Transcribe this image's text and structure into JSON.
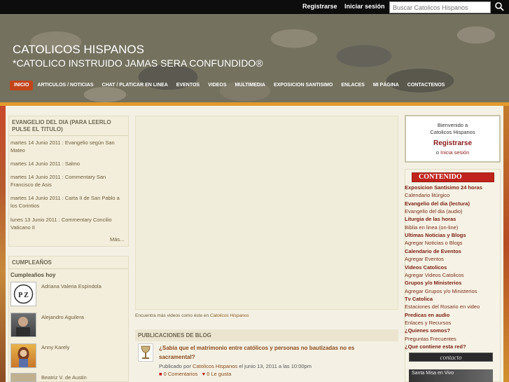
{
  "topbar": {
    "register": "Registrarse",
    "login": "Iniciar sesión",
    "search_placeholder": "Buscar Catolicos Hispanos"
  },
  "site": {
    "title": "CATOLICOS HISPANOS",
    "tagline": "*CATOLICO INSTRUIDO JAMAS SERA CONFUNDIDO®"
  },
  "nav": [
    "INICIO",
    "ARTICULOS / NOTICIAS",
    "CHAT / PLATICAR EN LINEA",
    "EVENTOS",
    "VIDEOS",
    "MULTIMEDIA",
    "EXPOSICION SANTISIMO",
    "ENLACES",
    "MI PÁGINA",
    "CONTACTENOS"
  ],
  "gospel": {
    "header": "EVANGELIO DEL DIA (PARA LEERLO PULSE EL TITULO)",
    "items": [
      "martes 14 Junio 2011 : Evangelio según San Mateo",
      "martes 14 Junio 2011 : Salmo",
      "martes 14 Junio 2011 : Commentary San Francisco de Asis",
      "martes 14 Junio 2011 : Carta II de San Pablo a los Corintios",
      "lunes 13 Junio 2011 : Commentary Concilio Vaticano II"
    ],
    "more": "Más..."
  },
  "birthdays": {
    "header": "CUMPLEAÑOS",
    "today": "Cumpleaños hoy",
    "people": [
      "Adriana Valeria Espindola",
      "Alejandro Aguilera",
      "Anny Karely",
      "Beatriz V. de Austin"
    ]
  },
  "video": {
    "caption_prefix": "Encuentra más videos como éste en",
    "caption_link": "Catolicos Hispanos"
  },
  "blog": {
    "header": "PUBLICACIONES DE BLOG",
    "post_title": "¿Sabía que el matrimonio entre católicos y personas no bautizadas no es sacramental?",
    "meta_by": "Publicado por",
    "author": "Catolicos Hispanos",
    "date": "el junio 13, 2011 a las 10:00pm",
    "comments": "0 Comentarios",
    "likes": "0 Le gusta"
  },
  "welcome": {
    "line1": "Bienvenido a",
    "line2": "Catolicos Hispanos",
    "register": "Registrarse",
    "or": "o",
    "login": "Inicia sesión"
  },
  "contenido": {
    "header": "CONTENIDO",
    "items": [
      {
        "label": "Exposicion Santisimo 24 horas",
        "bold": true
      },
      {
        "label": "Calendario litúrgico",
        "bold": false
      },
      {
        "label": "Evangelio del dia (lectura)",
        "bold": true
      },
      {
        "label": "Evangelio del dia (audio)",
        "bold": false
      },
      {
        "label": "Liturgia de las horas",
        "bold": true
      },
      {
        "label": "Biblia en linea (on-line)",
        "bold": false
      },
      {
        "label": "Ultimas Noticias y Blogs",
        "bold": true
      },
      {
        "label": "Agregar Noticias o Blogs",
        "bold": false
      },
      {
        "label": "Calendario de Eventos",
        "bold": true
      },
      {
        "label": "Agregar Eventos",
        "bold": false
      },
      {
        "label": "Videos Catolicos",
        "bold": true
      },
      {
        "label": "Agregar Videos Catolicos",
        "bold": false
      },
      {
        "label": "Grupos y/o Ministerios",
        "bold": true
      },
      {
        "label": "Agregar Grupos y/o Ministerios",
        "bold": false
      },
      {
        "label": "Tv Catolica",
        "bold": true
      },
      {
        "label": "Estaciones del Rosario en video",
        "bold": false
      },
      {
        "label": "Predicas en audio",
        "bold": true
      },
      {
        "label": "Enlaces y Recursos",
        "bold": false
      },
      {
        "label": "¿Quienes somos?",
        "bold": true
      },
      {
        "label": "Preguntas Frecuentes",
        "bold": false
      },
      {
        "label": "¿Que contiene esta red?",
        "bold": true
      }
    ],
    "contact_banner": "contacto",
    "live_banner": "Santa Misa en Vivo"
  }
}
